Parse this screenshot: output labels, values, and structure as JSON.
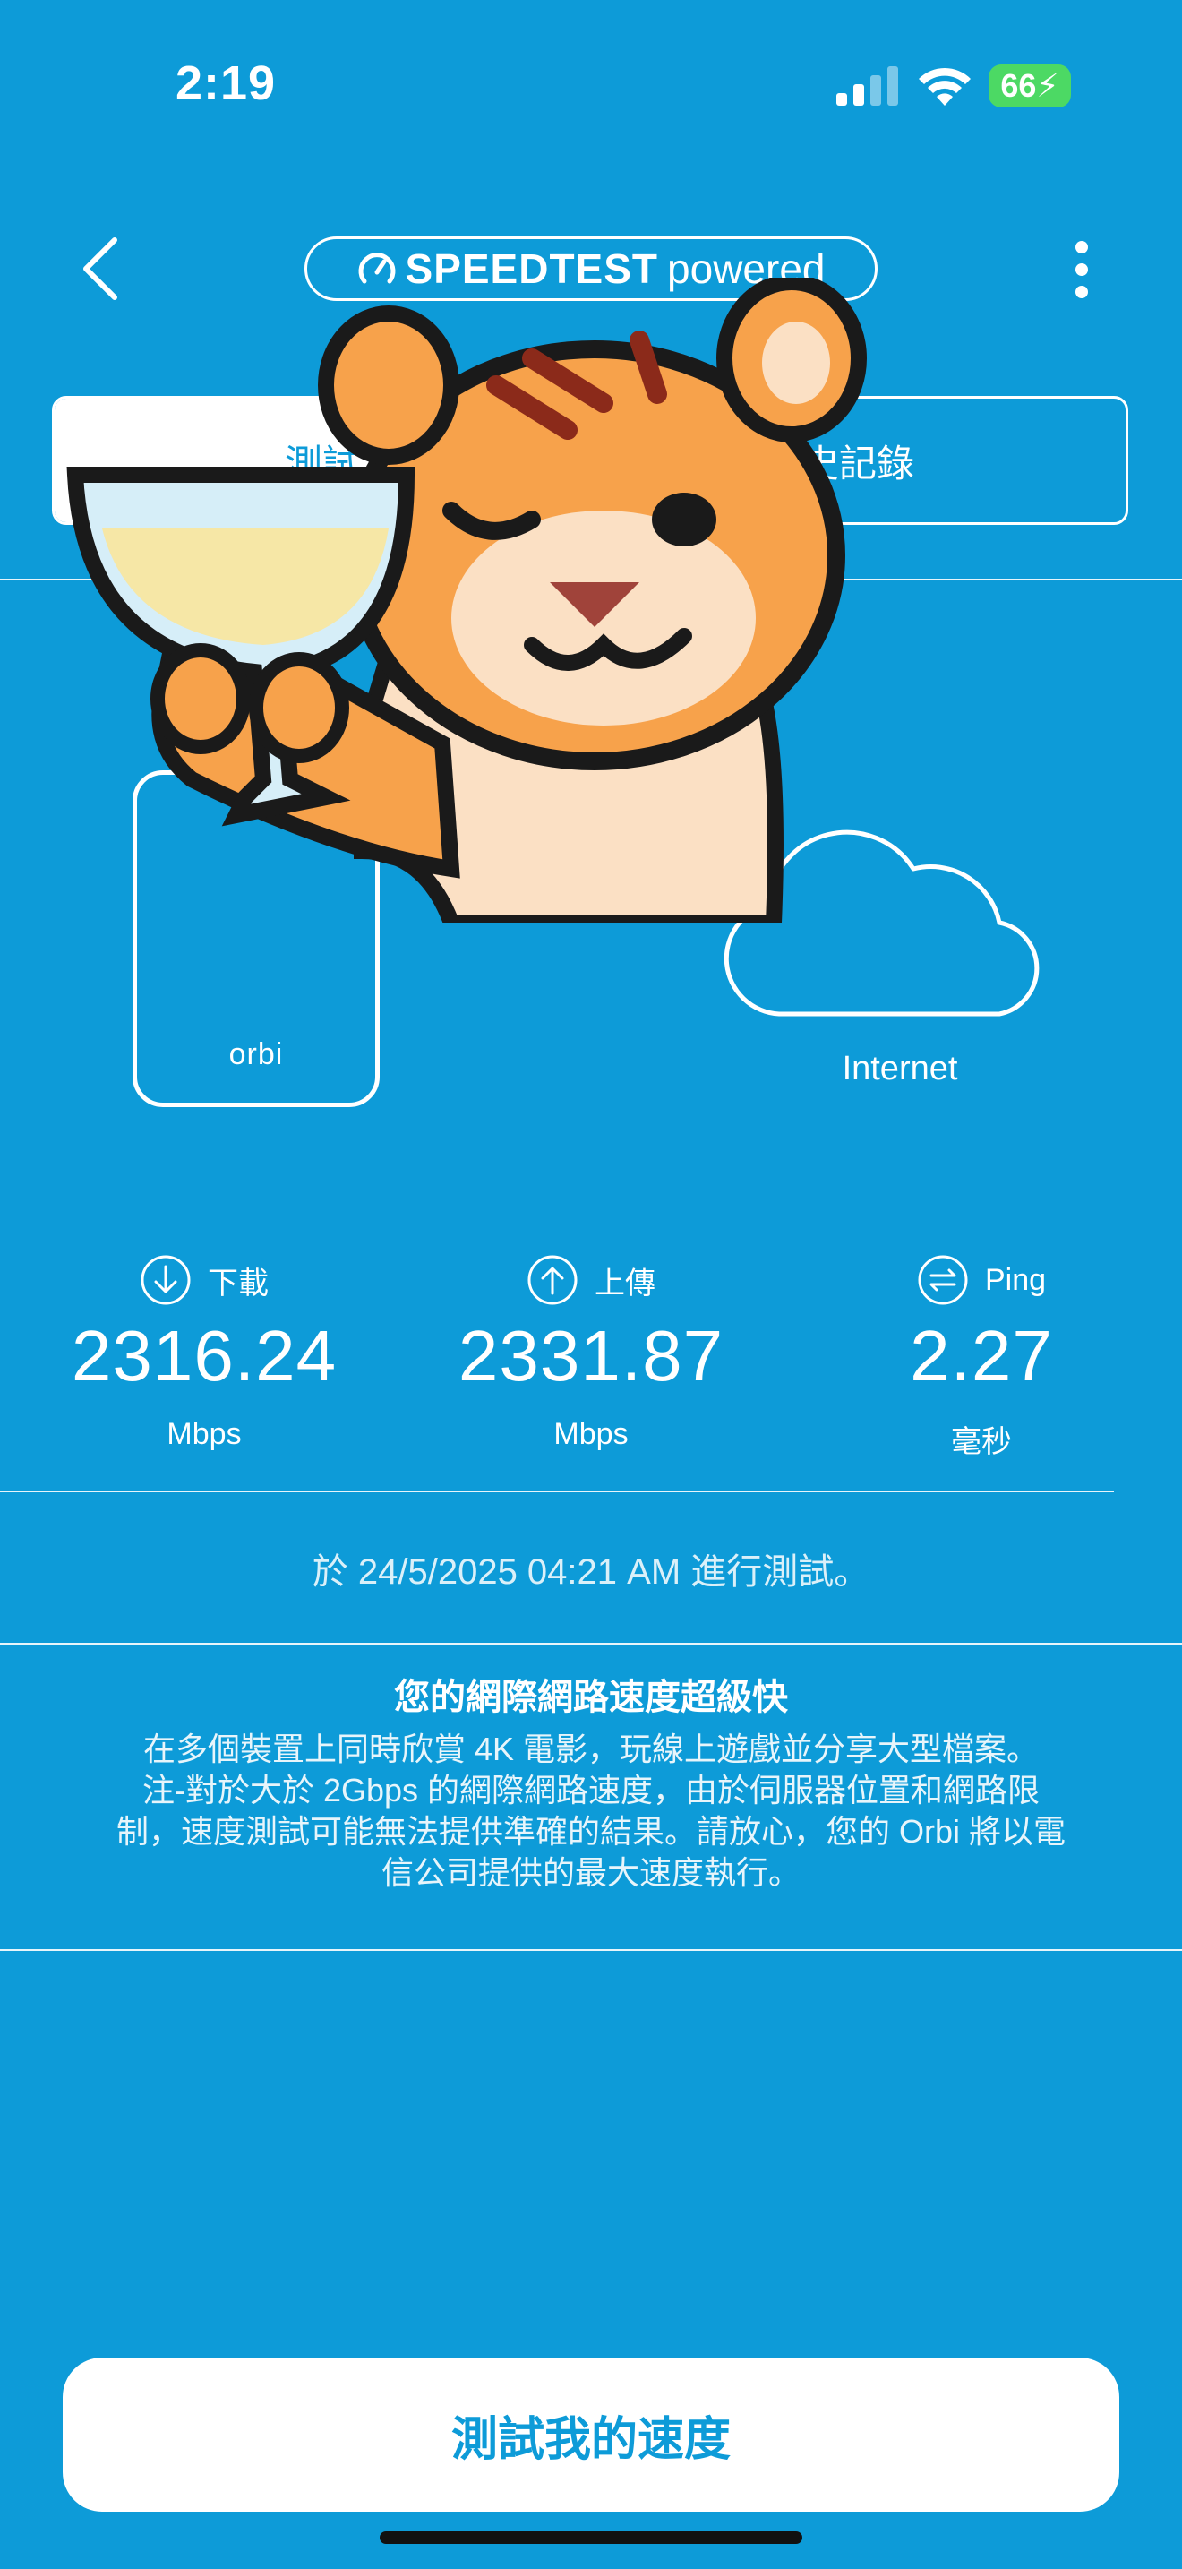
{
  "status_bar": {
    "time": "2:19",
    "battery": "66"
  },
  "header": {
    "brand": "SPEEDTEST",
    "powered": "powered"
  },
  "tabs": [
    {
      "label": "測試"
    },
    {
      "label": "史記錄"
    }
  ],
  "devices": {
    "router_label": "orbi",
    "internet_label": "Internet"
  },
  "stats": [
    {
      "label": "下載",
      "value": "2316.24",
      "unit": "Mbps",
      "icon": "download-arrow-icon"
    },
    {
      "label": "上傳",
      "value": "2331.87",
      "unit": "Mbps",
      "icon": "upload-arrow-icon"
    },
    {
      "label": "Ping",
      "value": "2.27",
      "unit": "毫秒",
      "icon": "ping-icon"
    }
  ],
  "tested_at": "於 24/5/2025 04:21 AM 進行測試。",
  "message": {
    "title": "您的網際網路速度超級快",
    "lines": [
      "在多個裝置上同時欣賞 4K 電影，玩線上遊戲並分享大型檔案。",
      "注-對於大於 2Gbps 的網際網路速度，由於伺服器位置和網路限",
      "制，速度測試可能無法提供準確的結果。請放心，您的 Orbi 將以電",
      "信公司提供的最大速度執行。"
    ]
  },
  "action": {
    "label": "測試我的速度"
  },
  "colors": {
    "background": "#0d9bd8",
    "accent": "#0d9bd8",
    "battery": "#4cd964"
  }
}
